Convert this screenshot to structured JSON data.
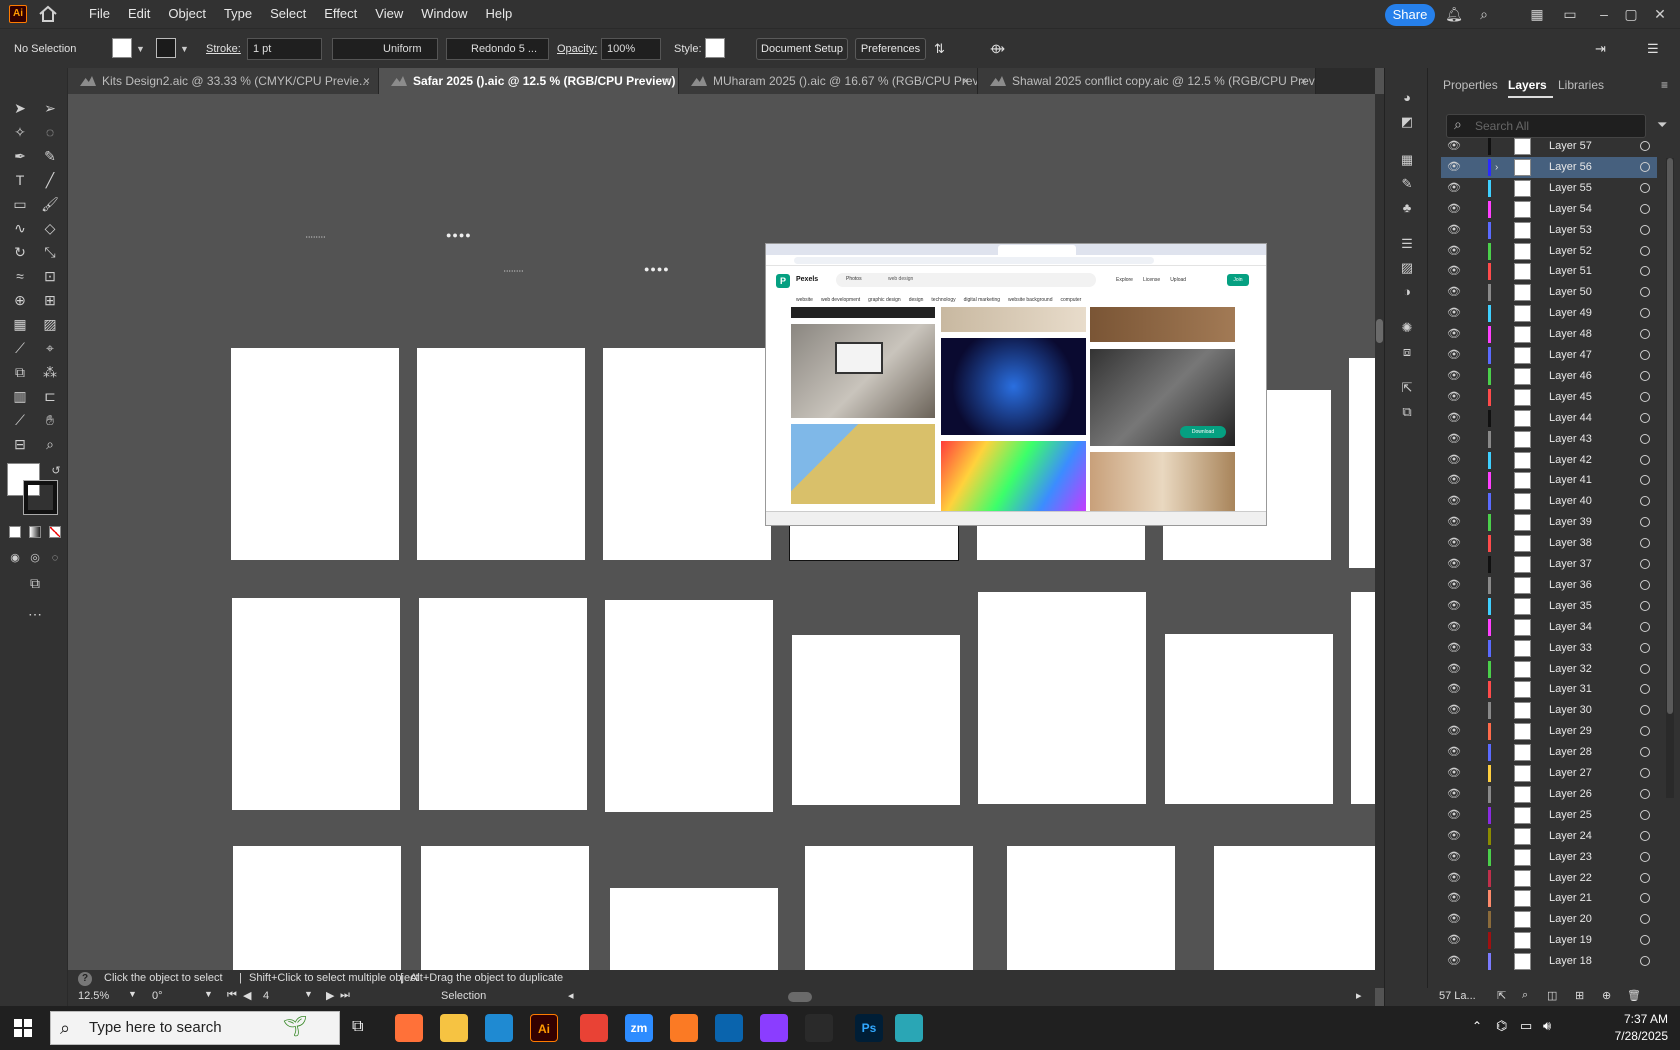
{
  "app": {
    "logo": "Ai"
  },
  "menu": [
    "File",
    "Edit",
    "Object",
    "Type",
    "Select",
    "Effect",
    "View",
    "Window",
    "Help"
  ],
  "topbar": {
    "share": "Share"
  },
  "control": {
    "selection": "No Selection",
    "stroke_label": "Stroke:",
    "stroke_value": "1 pt",
    "stroke_profile": "Uniform",
    "brush": "Redondo 5 ...",
    "opacity_label": "Opacity:",
    "opacity_value": "100%",
    "style_label": "Style:",
    "document_setup": "Document Setup",
    "preferences": "Preferences"
  },
  "tabs": [
    {
      "label": "Kits Design2.aic @ 33.33 % (CMYK/CPU Previe...",
      "close": "×"
    },
    {
      "label": "Safar 2025 ().aic @ 12.5 % (RGB/CPU Preview)",
      "close": "×"
    },
    {
      "label": "MUharam 2025 ().aic @ 16.67 % (RGB/CPU Previe...",
      "close": "×"
    },
    {
      "label": "Shawal 2025 conflict copy.aic @ 12.5 % (RGB/CPU Previe...",
      "close": "×"
    }
  ],
  "status": {
    "hint_a": "Click the object to select",
    "hint_b": "Shift+Click to select multiple object",
    "hint_c": "Alt+Drag the object to duplicate",
    "zoom": "12.5%",
    "rotation": "0°",
    "artboard": "4",
    "tool": "Selection"
  },
  "panel": {
    "tabs": [
      "Properties",
      "Layers",
      "Libraries"
    ],
    "search_placeholder": "Search All",
    "footer_count": "57 La...",
    "layers": [
      {
        "name": "Layer 57",
        "color": "#111111"
      },
      {
        "name": "Layer 56",
        "color": "#2b2bff",
        "selected": true,
        "expand": "›"
      },
      {
        "name": "Layer 55",
        "color": "#3fd0ff"
      },
      {
        "name": "Layer 54",
        "color": "#ff40ff"
      },
      {
        "name": "Layer 53",
        "color": "#5b6bff"
      },
      {
        "name": "Layer 52",
        "color": "#4bd04b"
      },
      {
        "name": "Layer 51",
        "color": "#ff4b4b"
      },
      {
        "name": "Layer 50",
        "color": "#8a8a8a"
      },
      {
        "name": "Layer 49",
        "color": "#3fd0ff"
      },
      {
        "name": "Layer 48",
        "color": "#ff40ff"
      },
      {
        "name": "Layer 47",
        "color": "#5b6bff"
      },
      {
        "name": "Layer 46",
        "color": "#4bd04b"
      },
      {
        "name": "Layer 45",
        "color": "#ff4b4b"
      },
      {
        "name": "Layer 44",
        "color": "#111111"
      },
      {
        "name": "Layer 43",
        "color": "#8a8a8a"
      },
      {
        "name": "Layer 42",
        "color": "#3fd0ff"
      },
      {
        "name": "Layer 41",
        "color": "#ff40ff"
      },
      {
        "name": "Layer 40",
        "color": "#5b6bff"
      },
      {
        "name": "Layer 39",
        "color": "#4bd04b"
      },
      {
        "name": "Layer 38",
        "color": "#ff4b4b"
      },
      {
        "name": "Layer 37",
        "color": "#111111"
      },
      {
        "name": "Layer 36",
        "color": "#8a8a8a"
      },
      {
        "name": "Layer 35",
        "color": "#3fd0ff"
      },
      {
        "name": "Layer 34",
        "color": "#ff40ff"
      },
      {
        "name": "Layer 33",
        "color": "#5b6bff"
      },
      {
        "name": "Layer 32",
        "color": "#4bd04b"
      },
      {
        "name": "Layer 31",
        "color": "#ff4b4b"
      },
      {
        "name": "Layer 30",
        "color": "#8a8a8a"
      },
      {
        "name": "Layer 29",
        "color": "#ff6b4b"
      },
      {
        "name": "Layer 28",
        "color": "#5b6bff"
      },
      {
        "name": "Layer 27",
        "color": "#ffd040"
      },
      {
        "name": "Layer 26",
        "color": "#8a8a8a"
      },
      {
        "name": "Layer 25",
        "color": "#8a2be2"
      },
      {
        "name": "Layer 24",
        "color": "#8b8b00"
      },
      {
        "name": "Layer 23",
        "color": "#4bd04b"
      },
      {
        "name": "Layer 22",
        "color": "#c0304b"
      },
      {
        "name": "Layer 21",
        "color": "#ff8a6b"
      },
      {
        "name": "Layer 20",
        "color": "#8b6b3b"
      },
      {
        "name": "Layer 19",
        "color": "#a01010"
      },
      {
        "name": "Layer 18",
        "color": "#7b7bff"
      }
    ]
  },
  "screenshot": {
    "site": "Pexels",
    "category": "Photos",
    "query": "web design",
    "nav": [
      "Explore",
      "License",
      "Upload"
    ],
    "join": "Join",
    "chips": [
      "website",
      "web development",
      "graphic design",
      "design",
      "technology",
      "digital marketing",
      "website background",
      "computer"
    ],
    "download": "Download"
  },
  "taskbar": {
    "search": "Type here to search",
    "time": "7:37 AM",
    "date": "7/28/2025",
    "apps": [
      {
        "name": "firefox",
        "label": "",
        "color": "#ff7139"
      },
      {
        "name": "explorer",
        "label": "",
        "color": "#f6c342"
      },
      {
        "name": "vscode",
        "label": "",
        "color": "#1f8ad2"
      },
      {
        "name": "illustrator",
        "label": "Ai",
        "color": "#330000"
      },
      {
        "name": "chrome",
        "label": "",
        "color": "#e94235"
      },
      {
        "name": "zoom",
        "label": "zm",
        "color": "#2d8cff"
      },
      {
        "name": "xampp",
        "label": "",
        "color": "#fb7a24"
      },
      {
        "name": "outlook",
        "label": "",
        "color": "#0a64ad"
      },
      {
        "name": "canva",
        "label": "",
        "color": "#8b3dff"
      },
      {
        "name": "pen",
        "label": "",
        "color": "#2a2a2a"
      },
      {
        "name": "photoshop",
        "label": "Ps",
        "color": "#001e36"
      },
      {
        "name": "gem",
        "label": "",
        "color": "#2aa6b5"
      }
    ]
  }
}
